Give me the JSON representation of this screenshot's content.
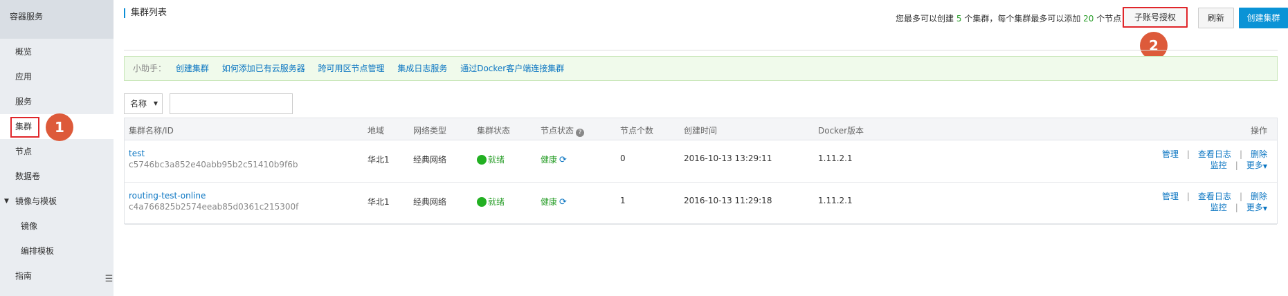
{
  "sidebar": {
    "title": "容器服务",
    "items": [
      {
        "label": "概览"
      },
      {
        "label": "应用"
      },
      {
        "label": "服务"
      },
      {
        "label": "集群"
      },
      {
        "label": "节点"
      },
      {
        "label": "数据卷"
      },
      {
        "label": "镜像与模板"
      },
      {
        "label": "镜像"
      },
      {
        "label": "编排模板"
      },
      {
        "label": "指南"
      }
    ],
    "active": "集群"
  },
  "annotations": {
    "badge1": "1",
    "badge2": "2",
    "highlight_color": "#e0262a",
    "badge_color": "#dd5a3a"
  },
  "header": {
    "title": "集群列表",
    "summary_prefix": "您最多可以创建",
    "max_clusters": "5",
    "summary_mid": "个集群，每个集群最多可以添加",
    "max_nodes": "20",
    "summary_suffix": "个节点",
    "buttons": {
      "sub_account": "子账号授权",
      "refresh": "刷新",
      "create": "创建集群"
    }
  },
  "helper": {
    "label": "小助手：",
    "links": [
      "创建集群",
      "如何添加已有云服务器",
      "跨可用区节点管理",
      "集成日志服务",
      "通过Docker客户端连接集群"
    ]
  },
  "filter": {
    "select_value": "名称",
    "input_value": ""
  },
  "table": {
    "columns": [
      "集群名称/ID",
      "地域",
      "网络类型",
      "集群状态",
      "节点状态",
      "节点个数",
      "创建时间",
      "Docker版本",
      "操作"
    ],
    "rows": [
      {
        "name": "test",
        "id": "c5746bc3a852e40abb95b2c51410b9f6b",
        "region": "华北1",
        "network": "经典网络",
        "status": "就绪",
        "node_status": "健康",
        "node_count": "0",
        "created": "2016-10-13 13:29:11",
        "docker": "1.11.2.1"
      },
      {
        "name": "routing-test-online",
        "id": "c4a766825b2574eeab85d0361c215300f",
        "region": "华北1",
        "network": "经典网络",
        "status": "就绪",
        "node_status": "健康",
        "node_count": "1",
        "created": "2016-10-13 11:29:18",
        "docker": "1.11.2.1"
      }
    ],
    "actions": {
      "manage": "管理",
      "logs": "查看日志",
      "delete": "删除",
      "monitor": "监控",
      "more": "更多"
    }
  },
  "colors": {
    "primary": "#0a93d6",
    "link": "#0a75c2",
    "success": "#22b022"
  }
}
